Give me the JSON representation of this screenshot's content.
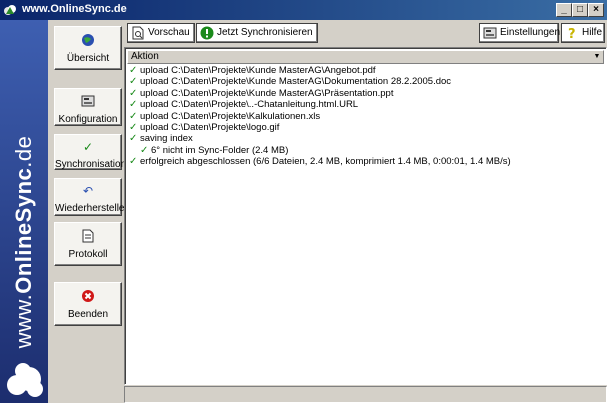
{
  "window": {
    "title": "www.OnlineSync.de",
    "controls": {
      "minimize": "_",
      "maximize": "□",
      "close": "×"
    }
  },
  "brand": {
    "prefix": "www.",
    "name": "OnlineSync",
    "suffix": ".de"
  },
  "nav": [
    {
      "label": "Übersicht",
      "icon": "globe-icon"
    },
    {
      "label": "Konfiguration",
      "icon": "config-icon"
    },
    {
      "label": "Synchronisation",
      "icon": "check-icon"
    },
    {
      "label": "Wiederherstellen",
      "icon": "undo-icon"
    },
    {
      "label": "Protokoll",
      "icon": "document-icon"
    },
    {
      "label": "Beenden",
      "icon": "stop-icon"
    }
  ],
  "toolbar": {
    "preview": "Vorschau",
    "sync_now": "Jetzt Synchronisieren",
    "settings": "Einstellungen",
    "help": "Hilfe"
  },
  "log": {
    "column": "Aktion",
    "rows": [
      "upload C:\\Daten\\Projekte\\Kunde MasterAG\\Angebot.pdf",
      "upload C:\\Daten\\Projekte\\Kunde MasterAG\\Dokumentation 28.2.2005.doc",
      "upload C:\\Daten\\Projekte\\Kunde MasterAG\\Präsentation.ppt",
      "upload C:\\Daten\\Projekte\\..-Chatanleitung.html.URL",
      "upload C:\\Daten\\Projekte\\Kalkulationen.xls",
      "upload C:\\Daten\\Projekte\\logo.gif",
      "saving index",
      "6° nicht im Sync-Folder  (2.4 MB)",
      "erfolgreich abgeschlossen   (6/6 Dateien, 2.4 MB, komprimiert 1.4 MB, 0:00:01, 1.4 MB/s)"
    ]
  },
  "colors": {
    "brand_top": "#3e5fb1",
    "brand_bottom": "#1c2d6e",
    "check": "#1a8a1a"
  }
}
